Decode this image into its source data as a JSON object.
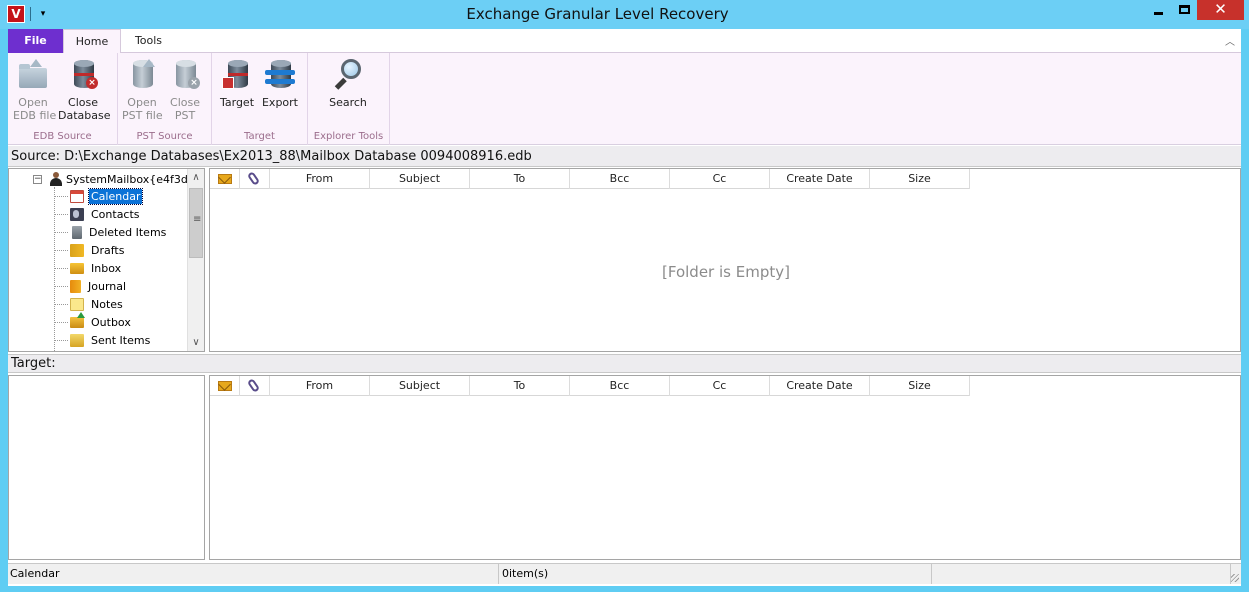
{
  "window": {
    "title": "Exchange Granular Level Recovery",
    "app_icon_letter": "V",
    "controls": {
      "minimize": "minimize",
      "maximize": "maximize",
      "close": "✕"
    }
  },
  "tabs": [
    {
      "label": "File",
      "active": false
    },
    {
      "label": "Home",
      "active": true
    },
    {
      "label": "Tools",
      "active": false
    }
  ],
  "ribbon": {
    "groups": [
      {
        "label": "EDB Source",
        "buttons": [
          {
            "line1": "Open",
            "line2": "EDB file",
            "icon": "open-folder-icon",
            "enabled": false
          },
          {
            "line1": "Close",
            "line2": "Database",
            "icon": "close-database-icon",
            "enabled": true
          }
        ]
      },
      {
        "label": "PST Source",
        "buttons": [
          {
            "line1": "Open",
            "line2": "PST file",
            "icon": "open-pst-icon",
            "enabled": false
          },
          {
            "line1": "Close",
            "line2": "PST",
            "icon": "close-pst-icon",
            "enabled": false
          }
        ]
      },
      {
        "label": "Target",
        "buttons": [
          {
            "line1": "Target",
            "line2": "",
            "icon": "target-database-icon",
            "enabled": true
          },
          {
            "line1": "Export",
            "line2": "",
            "icon": "export-icon",
            "enabled": true
          }
        ]
      },
      {
        "label": "Explorer Tools",
        "buttons": [
          {
            "line1": "Search",
            "line2": "",
            "icon": "search-icon",
            "enabled": true
          }
        ]
      }
    ]
  },
  "source": {
    "path_text": "Source: D:\\Exchange Databases\\Ex2013_88\\Mailbox Database 0094008916.edb"
  },
  "tree": {
    "root": {
      "label": "SystemMailbox{e4f3d7",
      "expander": "−"
    },
    "items": [
      {
        "label": "Calendar",
        "icon": "calendar-icon",
        "selected": true
      },
      {
        "label": "Contacts",
        "icon": "contacts-icon",
        "selected": false
      },
      {
        "label": "Deleted Items",
        "icon": "trash-icon",
        "selected": false
      },
      {
        "label": "Drafts",
        "icon": "drafts-icon",
        "selected": false
      },
      {
        "label": "Inbox",
        "icon": "inbox-icon",
        "selected": false
      },
      {
        "label": "Journal",
        "icon": "journal-icon",
        "selected": false
      },
      {
        "label": "Notes",
        "icon": "notes-icon",
        "selected": false
      },
      {
        "label": "Outbox",
        "icon": "outbox-icon",
        "selected": false
      },
      {
        "label": "Sent Items",
        "icon": "sent-items-icon",
        "selected": false
      }
    ],
    "scroll_up": "∧",
    "scroll_down": "∨"
  },
  "grid": {
    "columns": [
      "From",
      "Subject",
      "To",
      "Bcc",
      "Cc",
      "Create Date",
      "Size"
    ],
    "icon_columns": [
      "mail-icon",
      "attachment-icon"
    ],
    "empty_message": "[Folder is Empty]"
  },
  "target": {
    "label": "Target:"
  },
  "status": {
    "folder": "Calendar",
    "count": "0item(s)",
    "extra": ""
  },
  "colors": {
    "file_tab": "#6e2fcf",
    "ribbon_bg": "#fbf3fc",
    "selection": "#0c73d7",
    "close_button": "#c7312b",
    "window_frame": "#5fcdf3"
  }
}
